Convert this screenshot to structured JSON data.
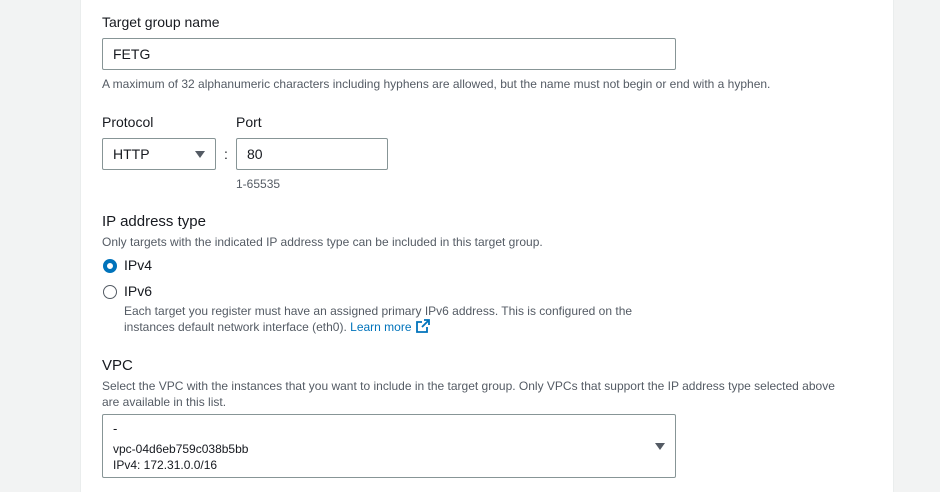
{
  "target_group_name": {
    "label": "Target group name",
    "value": "FETG",
    "hint": "A maximum of 32 alphanumeric characters including hyphens are allowed, but the name must not begin or end with a hyphen."
  },
  "protocol": {
    "label": "Protocol",
    "value": "HTTP",
    "separator": ":"
  },
  "port": {
    "label": "Port",
    "value": "80",
    "hint": "1-65535"
  },
  "ip_address_type": {
    "label": "IP address type",
    "description": "Only targets with the indicated IP address type can be included in this target group.",
    "options": [
      {
        "label": "IPv4",
        "selected": true
      },
      {
        "label": "IPv6",
        "selected": false
      }
    ],
    "ipv6_description_line1": "Each target you register must have an assigned primary IPv6 address. This is configured on the",
    "ipv6_description_line2": "instances default network interface (eth0).",
    "learn_more": "Learn more"
  },
  "vpc": {
    "label": "VPC",
    "description_line1": "Select the VPC with the instances that you want to include in the target group. Only VPCs that support the IP address type selected above",
    "description_line2": "are available in this list.",
    "selected_name": "-",
    "selected_id": "vpc-04d6eb759c038b5bb",
    "selected_cidr": "IPv4: 172.31.0.0/16"
  },
  "colors": {
    "accent": "#0073bb",
    "text": "#16191f",
    "muted": "#545b64",
    "border": "#879596"
  },
  "icons": {
    "external": "external-link-icon",
    "dropdown": "caret-down-icon"
  }
}
